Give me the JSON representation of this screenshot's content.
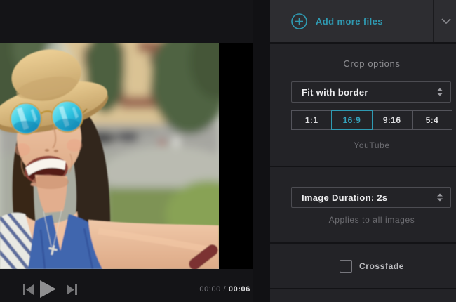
{
  "colors": {
    "accent": "#2f9ab2",
    "panel_bg": "#232327",
    "topbar_bg": "#2d2d31",
    "player_bg": "#141417",
    "page_bg": "#131316"
  },
  "icons": {
    "add": "plus-circle-icon",
    "collapse": "chevron-down-icon",
    "select_stepper": "stepper-icon",
    "previous": "previous-frame-icon",
    "play": "play-icon",
    "next": "next-frame-icon"
  },
  "player": {
    "time_current": "00:00",
    "time_separator": "/",
    "time_total": "00:06"
  },
  "panel": {
    "add_files_label": "Add more files",
    "crop": {
      "heading": "Crop options",
      "mode_value": "Fit with border",
      "ratios": [
        {
          "label": "1:1",
          "selected": false
        },
        {
          "label": "16:9",
          "selected": true
        },
        {
          "label": "9:16",
          "selected": false
        },
        {
          "label": "5:4",
          "selected": false
        }
      ],
      "preset_label": "YouTube"
    },
    "duration": {
      "value": "Image Duration: 2s",
      "note": "Applies to all images"
    },
    "crossfade": {
      "label": "Crossfade",
      "checked": false
    }
  }
}
